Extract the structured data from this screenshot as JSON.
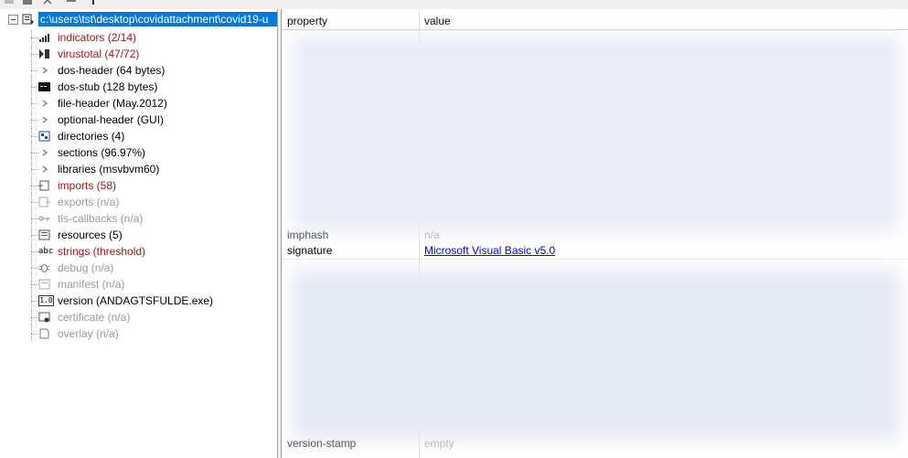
{
  "toolbar": {
    "icons": [
      "open-icon",
      "save-icon",
      "cut-icon",
      "list-icon",
      "info-icon"
    ]
  },
  "tree": {
    "root": {
      "label": "c:\\users\\tst\\desktop\\covidattachment\\covid19-u",
      "icon": "document-icon"
    },
    "items": [
      {
        "label": "indicators (2/14)",
        "style": "red",
        "icon": "indicators-icon"
      },
      {
        "label": "virustotal (47/72)",
        "style": "red",
        "icon": "virustotal-icon"
      },
      {
        "label": "dos-header (64 bytes)",
        "style": "normal",
        "icon": "arrow-icon"
      },
      {
        "label": "dos-stub (128 bytes)",
        "style": "normal",
        "icon": "console-icon"
      },
      {
        "label": "file-header (May.2012)",
        "style": "normal",
        "icon": "arrow-icon"
      },
      {
        "label": "optional-header (GUI)",
        "style": "normal",
        "icon": "arrow-icon"
      },
      {
        "label": "directories (4)",
        "style": "normal",
        "icon": "directories-icon"
      },
      {
        "label": "sections (96.97%)",
        "style": "normal",
        "icon": "arrow-icon"
      },
      {
        "label": "libraries (msvbvm60)",
        "style": "normal",
        "icon": "arrow-icon"
      },
      {
        "label": "imports (58)",
        "style": "red",
        "icon": "imports-icon"
      },
      {
        "label": "exports (n/a)",
        "style": "gray",
        "icon": "exports-icon"
      },
      {
        "label": "tls-callbacks (n/a)",
        "style": "gray",
        "icon": "tls-icon"
      },
      {
        "label": "resources (5)",
        "style": "normal",
        "icon": "resources-icon"
      },
      {
        "label": "strings (threshold)",
        "style": "red",
        "icon": "strings-icon"
      },
      {
        "label": "debug (n/a)",
        "style": "gray",
        "icon": "bug-icon"
      },
      {
        "label": "manifest (n/a)",
        "style": "gray",
        "icon": "manifest-icon"
      },
      {
        "label": "version (ANDAGTSFULDE.exe)",
        "style": "normal",
        "icon": "version-icon"
      },
      {
        "label": "certificate (n/a)",
        "style": "gray",
        "icon": "certificate-icon"
      },
      {
        "label": "overlay (n/a)",
        "style": "gray",
        "icon": "overlay-icon"
      }
    ],
    "icon_glyphs": {
      "abc": "abc",
      "ver": "1.0"
    }
  },
  "grid": {
    "header": {
      "property": "property",
      "value": "value"
    },
    "partial_rows": [
      {
        "property": "imphash",
        "value": "n/a"
      }
    ],
    "signature_row": {
      "property": "signature",
      "value": "Microsoft Visual Basic v5.0"
    },
    "bottom_row": {
      "property": "version-stamp",
      "value": "empty"
    }
  },
  "colors": {
    "selection": "#0078d7",
    "alert_red": "#9c1414",
    "disabled_gray": "#9a9a9a",
    "link_blue": "#0000cc"
  }
}
